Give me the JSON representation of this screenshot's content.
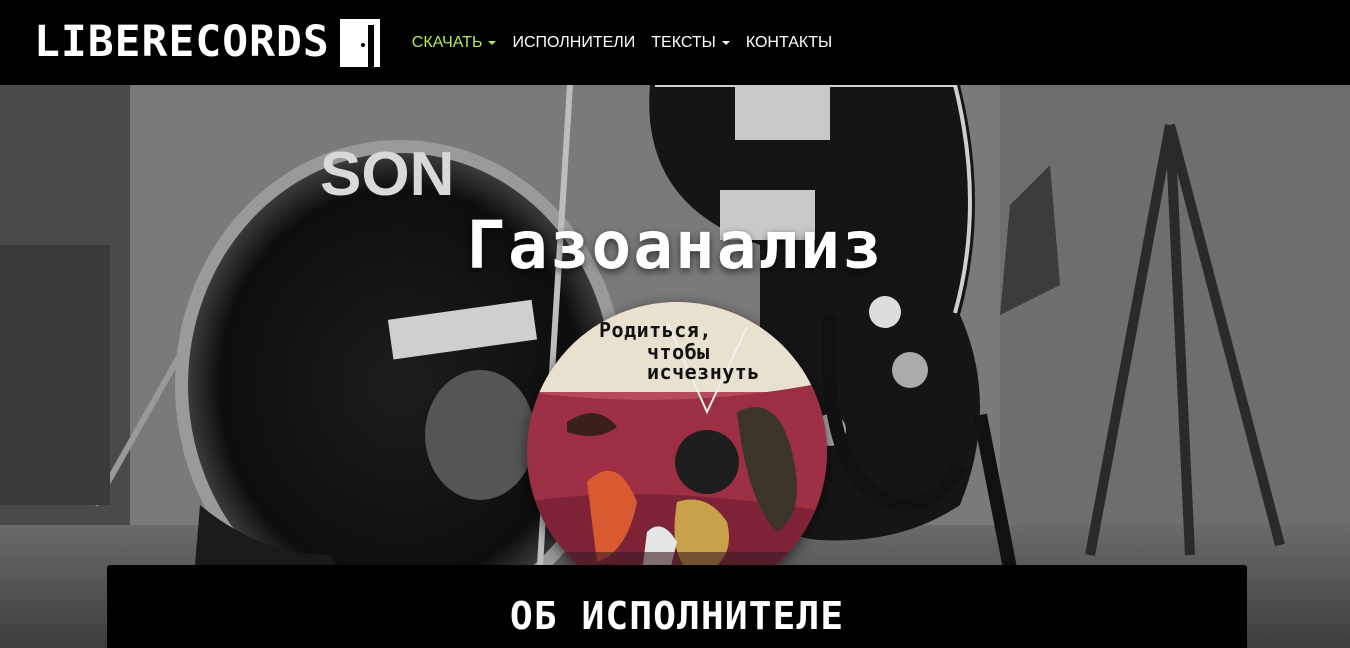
{
  "navbar": {
    "brand": "LIBERECORDS",
    "brand_icon": "door-icon",
    "items": [
      {
        "label": "СКАЧАТЬ",
        "dropdown": true,
        "active": true
      },
      {
        "label": "ИСПОЛНИТЕЛИ",
        "dropdown": false,
        "active": false
      },
      {
        "label": "ТЕКСТЫ",
        "dropdown": true,
        "active": false
      },
      {
        "label": "КОНТАКТЫ",
        "dropdown": false,
        "active": false
      }
    ],
    "active_color": "#b5e853"
  },
  "hero": {
    "artist_name": "Газоанализ",
    "cover": {
      "line1": "Родиться,",
      "line2": "чтобы",
      "line3": "исчезнуть"
    }
  },
  "about": {
    "title": "ОБ ИСПОЛНИТЕЛЕ"
  }
}
